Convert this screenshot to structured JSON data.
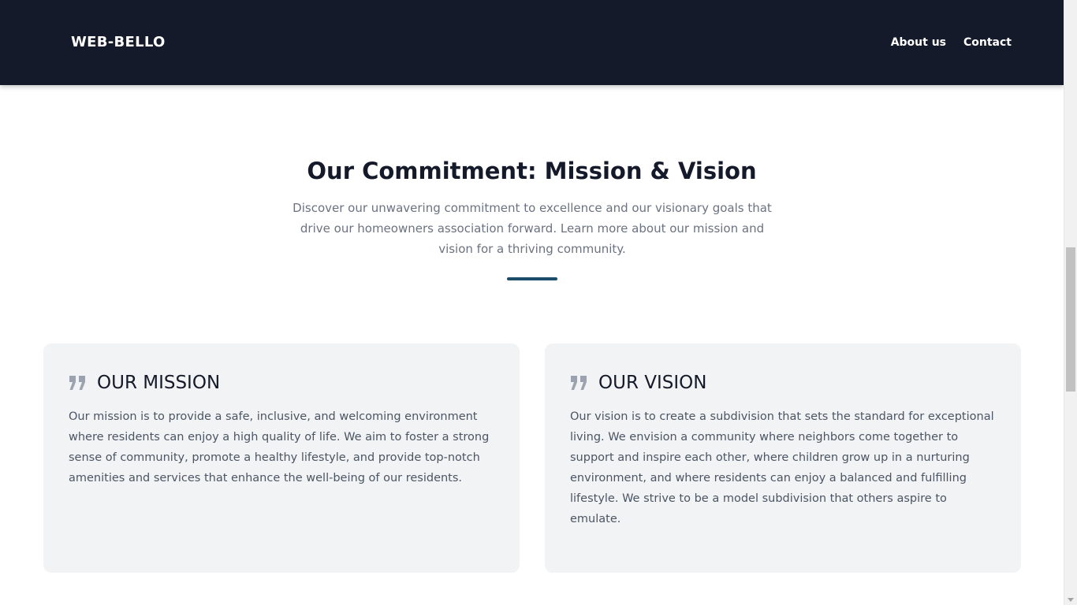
{
  "header": {
    "brand": "WEB-BELLO",
    "nav": [
      {
        "label": "About us"
      },
      {
        "label": "Contact"
      }
    ]
  },
  "section": {
    "title": "Our Commitment: Mission & Vision",
    "description": "Discover our unwavering commitment to excellence and our visionary goals that drive our homeowners association forward. Learn more about our mission and vision for a thriving community."
  },
  "cards": [
    {
      "icon": "quote-icon",
      "title": "OUR MISSION",
      "text": "Our mission is to provide a safe, inclusive, and welcoming environment where residents can enjoy a high quality of life. We aim to foster a strong sense of community, promote a healthy lifestyle, and provide top-notch amenities and services that enhance the well-being of our residents."
    },
    {
      "icon": "quote-icon",
      "title": "OUR VISION",
      "text": "Our vision is to create a subdivision that sets the standard for exceptional living. We envision a community where neighbors come together to support and inspire each other, where children grow up in a nurturing environment, and where residents can enjoy a balanced and fulfilling lifestyle. We strive to be a model subdivision that others aspire to emulate."
    }
  ],
  "colors": {
    "header_bg": "#141a29",
    "accent": "#1b4d6b",
    "card_bg": "#f2f3f5",
    "icon": "#9ca3af"
  }
}
